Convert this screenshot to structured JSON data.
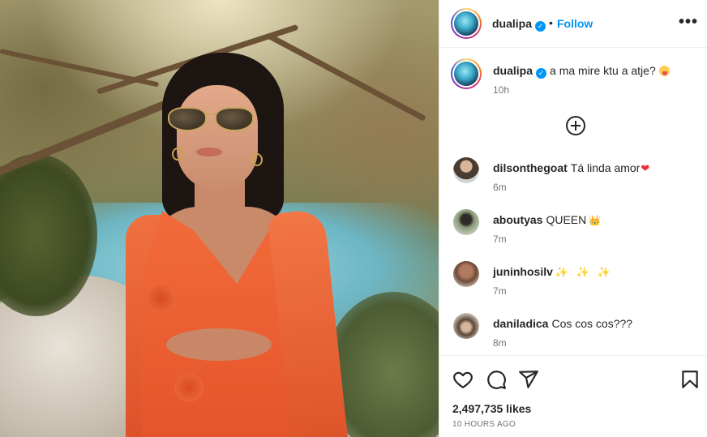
{
  "post": {
    "author": "dualipa",
    "verified_mark": "✓",
    "follow_label": "Follow",
    "separator": "•",
    "more_label": "•••",
    "caption": "a ma mire ktu a atje?",
    "caption_time": "10h",
    "likes": "2,497,735 likes",
    "time_ago": "10 HOURS AGO"
  },
  "comments": [
    {
      "user": "dilsonthegoat",
      "text": "Tá linda amor",
      "emoji": "❤",
      "emoji_icon": "heart-emoji-icon",
      "time": "6m",
      "avatar_color": "#6a5a4a"
    },
    {
      "user": "aboutyas",
      "text": "QUEEN",
      "emoji": "👑",
      "emoji_icon": "crown-emoji-icon",
      "time": "7m",
      "avatar_color": "#7a8a6a"
    },
    {
      "user": "juninhosilv",
      "text": "",
      "emoji": "✨ ✨ ✨",
      "emoji_icon": "sparkles-emoji-icon",
      "time": "7m",
      "avatar_color": "#8a6a5a"
    },
    {
      "user": "daniladica",
      "text": "Cos cos cos???",
      "emoji": "",
      "emoji_icon": "",
      "time": "8m",
      "avatar_color": "#9a8a7a"
    }
  ],
  "icons": {
    "like": "heart-outline-icon",
    "comment": "speech-bubble-icon",
    "share": "paper-plane-icon",
    "save": "bookmark-icon",
    "add": "plus-circle-icon",
    "more": "ellipsis-icon"
  },
  "colors": {
    "accent": "#0095f6",
    "text": "#262626",
    "muted": "#737373",
    "dress": "#f06a3a"
  }
}
